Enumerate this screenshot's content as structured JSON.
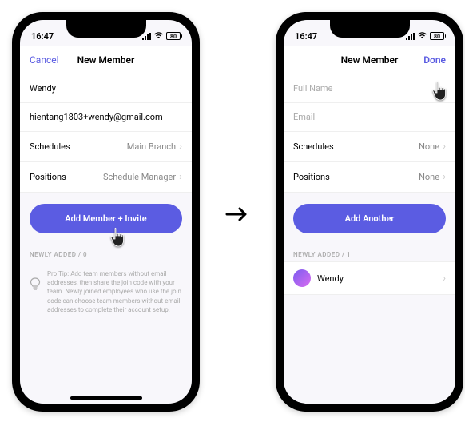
{
  "statusBar": {
    "time": "16:47",
    "batteryPercent": "80"
  },
  "left": {
    "nav": {
      "cancel": "Cancel",
      "title": "New Member"
    },
    "nameValue": "Wendy",
    "emailValue": "hientang1803+wendy@gmail.com",
    "schedulesLabel": "Schedules",
    "schedulesValue": "Main Branch",
    "positionsLabel": "Positions",
    "positionsValue": "Schedule Manager",
    "primaryButton": "Add Member + Invite",
    "newlyAdded": "NEWLY ADDED / 0",
    "tip": "Pro Tip: Add team members without email addresses, then share the join code with your team. Newly joined employees who use the join code can choose team members without email addresses to complete their account setup."
  },
  "right": {
    "nav": {
      "title": "New Member",
      "done": "Done"
    },
    "namePlaceholder": "Full Name",
    "emailPlaceholder": "Email",
    "schedulesLabel": "Schedules",
    "schedulesValue": "None",
    "positionsLabel": "Positions",
    "positionsValue": "None",
    "primaryButton": "Add Another",
    "newlyAdded": "NEWLY ADDED / 1",
    "memberName": "Wendy"
  }
}
